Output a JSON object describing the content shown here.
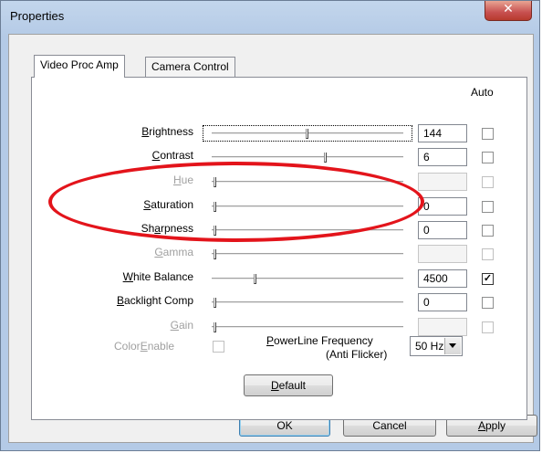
{
  "window": {
    "title": "Properties",
    "close_glyph": "✕"
  },
  "tabs": [
    {
      "label": "Video Proc Amp",
      "active": true
    },
    {
      "label": "Camera Control",
      "active": false
    }
  ],
  "auto_header": "Auto",
  "controls": [
    {
      "pre": "",
      "key": "B",
      "post": "rightness",
      "value": "144",
      "enabled": true,
      "auto": false,
      "level": 0.5
    },
    {
      "pre": "",
      "key": "C",
      "post": "ontrast",
      "value": "6",
      "enabled": true,
      "auto": false,
      "level": 0.6
    },
    {
      "pre": "",
      "key": "H",
      "post": "ue",
      "value": "",
      "enabled": false,
      "auto": false,
      "level": 0.0
    },
    {
      "pre": "",
      "key": "S",
      "post": "aturation",
      "value": "0",
      "enabled": true,
      "auto": false,
      "level": 0.0
    },
    {
      "pre": "Sh",
      "key": "a",
      "post": "rpness",
      "value": "0",
      "enabled": true,
      "auto": false,
      "level": 0.0
    },
    {
      "pre": "",
      "key": "G",
      "post": "amma",
      "value": "",
      "enabled": false,
      "auto": false,
      "level": 0.0
    },
    {
      "pre": "",
      "key": "W",
      "post": "hite Balance",
      "value": "4500",
      "enabled": true,
      "auto": true,
      "level": 0.22
    },
    {
      "pre": "",
      "key": "B",
      "post": "acklight Comp",
      "value": "0",
      "enabled": true,
      "auto": false,
      "level": 0.0
    },
    {
      "pre": "",
      "key": "G",
      "post": "ain",
      "value": "",
      "enabled": false,
      "auto": false,
      "level": 0.0
    }
  ],
  "color_enable": {
    "pre": "Color",
    "key": "E",
    "post": "nable",
    "checked": false
  },
  "powerline": {
    "line1_key": "P",
    "line1_rest": "owerLine Frequency",
    "line2": "(Anti Flicker)",
    "value": "50 Hz"
  },
  "buttons": {
    "default_key": "D",
    "default_rest": "efault",
    "ok": "OK",
    "cancel": "Cancel",
    "apply_key": "A",
    "apply_rest": "pply"
  },
  "colors": {
    "annotation": "#e3141b",
    "close_button": "#c75050"
  },
  "annotation": {
    "shape": "ellipse",
    "highlights": [
      "Saturation",
      "Sharpness"
    ]
  }
}
